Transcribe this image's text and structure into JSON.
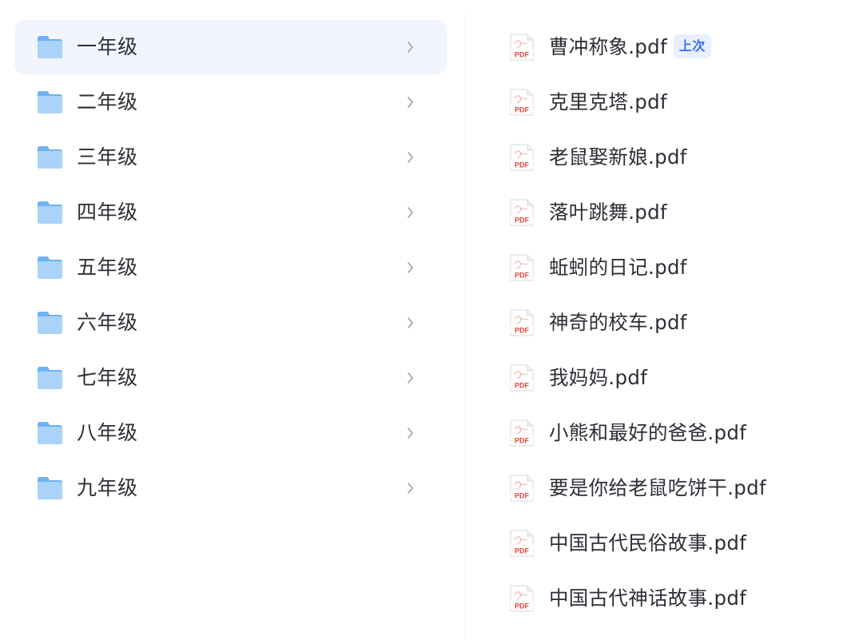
{
  "folders": [
    {
      "label": "一年级",
      "selected": true
    },
    {
      "label": "二年级",
      "selected": false
    },
    {
      "label": "三年级",
      "selected": false
    },
    {
      "label": "四年级",
      "selected": false
    },
    {
      "label": "五年级",
      "selected": false
    },
    {
      "label": "六年级",
      "selected": false
    },
    {
      "label": "七年级",
      "selected": false
    },
    {
      "label": "八年级",
      "selected": false
    },
    {
      "label": "九年级",
      "selected": false
    }
  ],
  "files": [
    {
      "name": "曹冲称象.pdf",
      "badge": "上次"
    },
    {
      "name": "克里克塔.pdf",
      "badge": ""
    },
    {
      "name": "老鼠娶新娘.pdf",
      "badge": ""
    },
    {
      "name": "落叶跳舞.pdf",
      "badge": ""
    },
    {
      "name": "蚯蚓的日记.pdf",
      "badge": ""
    },
    {
      "name": "神奇的校车.pdf",
      "badge": ""
    },
    {
      "name": "我妈妈.pdf",
      "badge": ""
    },
    {
      "name": "小熊和最好的爸爸.pdf",
      "badge": ""
    },
    {
      "name": "要是你给老鼠吃饼干.pdf",
      "badge": ""
    },
    {
      "name": "中国古代民俗故事.pdf",
      "badge": ""
    },
    {
      "name": "中国古代神话故事.pdf",
      "badge": ""
    }
  ],
  "icons": {
    "folder": "folder-icon",
    "chevron": "chevron-right-icon",
    "pdf": "pdf-file-icon",
    "pdf_text": "PDF"
  },
  "colors": {
    "selected_row_bg": "#f2f5fd",
    "folder_light": "#a9d3f9",
    "folder_dark": "#6fb2f3",
    "pdf_red": "#e8453c",
    "badge_bg": "#e8efff",
    "badge_text": "#3a6ff2"
  }
}
